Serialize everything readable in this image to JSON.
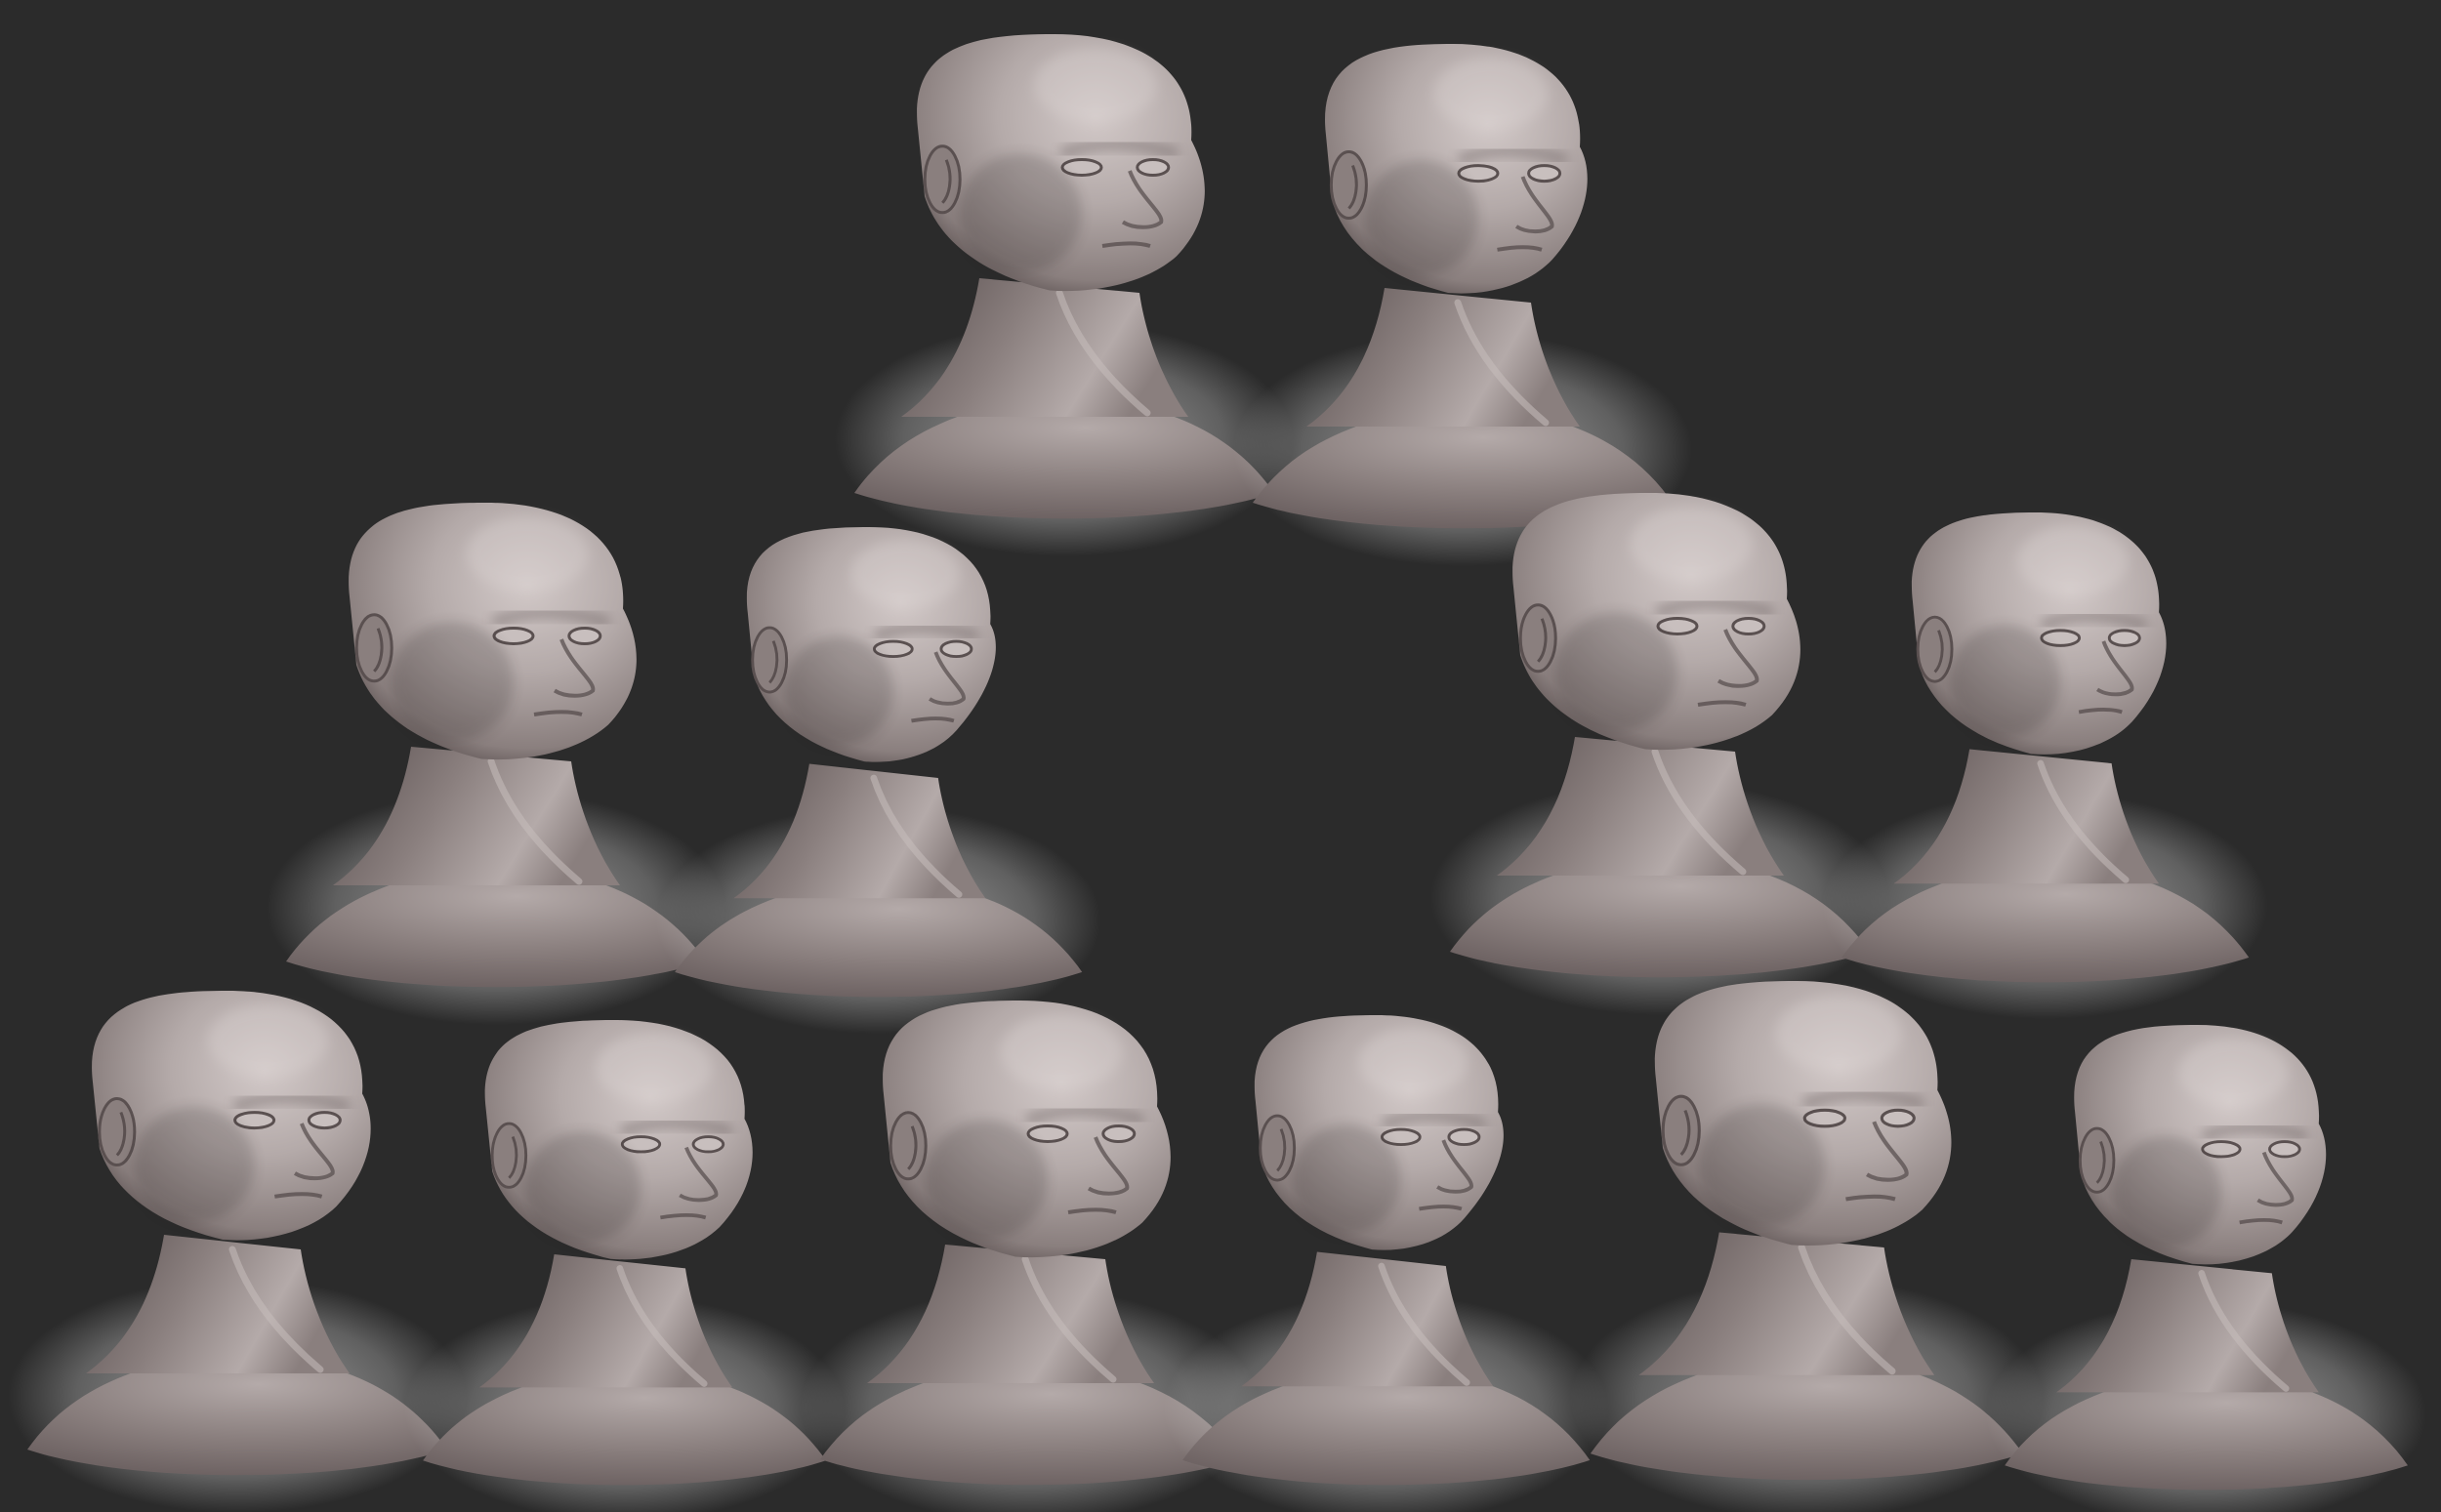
{
  "scene": {
    "background_color": "#2b2b2b",
    "clay_light": "#b4aaa9",
    "clay_mid": "#8a7f7e",
    "clay_dark": "#5a5050",
    "shadow_color": "#241f1f",
    "vignette_color": "#ffffff"
  },
  "figures": [
    {
      "id": "bust-1",
      "facing": "right",
      "shape": "broad-male"
    },
    {
      "id": "bust-2",
      "facing": "right",
      "shape": "lean-male"
    },
    {
      "id": "bust-3",
      "facing": "right",
      "shape": "broad-male"
    },
    {
      "id": "bust-4",
      "facing": "right",
      "shape": "lean-female"
    },
    {
      "id": "bust-5",
      "facing": "right",
      "shape": "broad-male"
    },
    {
      "id": "bust-6",
      "facing": "right",
      "shape": "lean-male"
    },
    {
      "id": "bust-7",
      "facing": "right",
      "shape": "round-female"
    },
    {
      "id": "bust-8",
      "facing": "right",
      "shape": "round-female"
    },
    {
      "id": "bust-9",
      "facing": "right",
      "shape": "broad-male"
    },
    {
      "id": "bust-10",
      "facing": "right",
      "shape": "lean-female"
    },
    {
      "id": "bust-11",
      "facing": "right",
      "shape": "broad-male"
    },
    {
      "id": "bust-12",
      "facing": "right",
      "shape": "lean-male"
    }
  ]
}
